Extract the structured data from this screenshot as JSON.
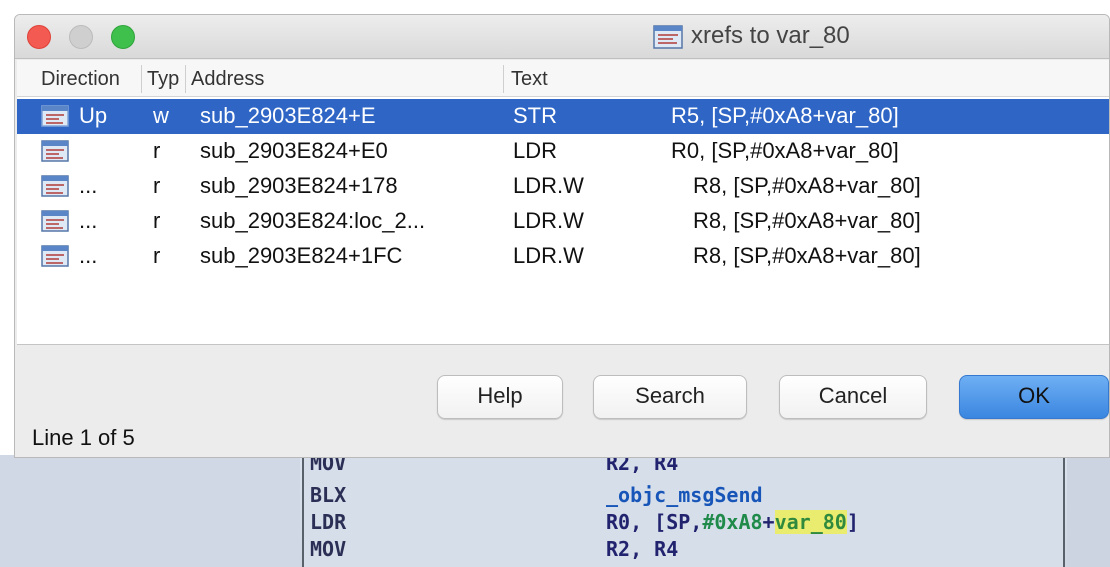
{
  "window": {
    "title": "xrefs to var_80",
    "title_icon": "function-window-icon"
  },
  "list": {
    "columns": [
      "Direction",
      "Typ",
      "Address",
      "Text"
    ],
    "rows": [
      {
        "direction": "Up",
        "type": "w",
        "address": "sub_2903E824+E",
        "mnemonic": "STR",
        "operands": "R5, [SP,#0xA8+var_80]",
        "selected": true
      },
      {
        "direction": "",
        "type": "r",
        "address": "sub_2903E824+E0",
        "mnemonic": "LDR",
        "operands": "R0, [SP,#0xA8+var_80]",
        "selected": false
      },
      {
        "direction": "...",
        "type": "r",
        "address": "sub_2903E824+178",
        "mnemonic": "LDR.W",
        "operands": "R8, [SP,#0xA8+var_80]",
        "selected": false
      },
      {
        "direction": "...",
        "type": "r",
        "address": "sub_2903E824:loc_2...",
        "mnemonic": "LDR.W",
        "operands": "R8, [SP,#0xA8+var_80]",
        "selected": false
      },
      {
        "direction": "...",
        "type": "r",
        "address": "sub_2903E824+1FC",
        "mnemonic": "LDR.W",
        "operands": "R8, [SP,#0xA8+var_80]",
        "selected": false
      }
    ]
  },
  "buttons": {
    "help": "Help",
    "search": "Search",
    "cancel": "Cancel",
    "ok": "OK"
  },
  "status": "Line 1 of 5",
  "background_code": [
    {
      "mnemonic": "MOV",
      "operands": "R2, R4"
    },
    {
      "mnemonic": "BLX",
      "operands": "_objc_msgSend"
    },
    {
      "mnemonic": "LDR",
      "operand_reg": "R0, [SP,",
      "operand_num": "#0xA8",
      "operand_plus": "+",
      "operand_var": "var_80",
      "operand_end": "]"
    },
    {
      "mnemonic": "MOV",
      "operands": "R2, R4"
    }
  ],
  "colors": {
    "selection": "#2f66c6",
    "ok_button": "#3a86e0",
    "highlight": "#e9ec6e"
  }
}
